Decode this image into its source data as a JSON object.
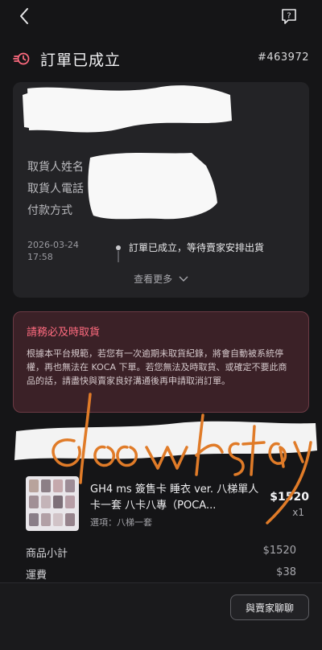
{
  "order": {
    "status_title": "訂單已成立",
    "order_number": "#463972"
  },
  "recipient": {
    "name_label": "取貨人姓名",
    "phone_label": "取貨人電話",
    "payment_label": "付款方式"
  },
  "timeline": {
    "date": "2026-03-24",
    "time": "17:58",
    "event": "訂單已成立，等待賣家安排出貨",
    "see_more": "查看更多"
  },
  "alert": {
    "title": "請務必及時取貨",
    "body": "根據本平台規範，若您有一次逾期未取貨紀錄，將會自動被系統停權，再也無法在 KOCA 下單。若您無法及時取貨、或確定不要此商品的話，請盡快與賣家良好溝通後再申請取消訂單。"
  },
  "product": {
    "name": "GH4 ms 簽售卡 睡衣 ver. 八梯單人卡一套 八卡八專（POCA...",
    "option": "選項：八梯一套",
    "price": "$1520",
    "quantity": "x1"
  },
  "summary": {
    "subtotal_label": "商品小計",
    "subtotal_value": "$1520",
    "shipping_label": "運費",
    "shipping_value": "$38"
  },
  "actions": {
    "chat_label": "與賣家聊聊"
  },
  "colors": {
    "accent": "#ff6b7f",
    "scribble_orange": "#e07b28",
    "background": "#151517"
  }
}
